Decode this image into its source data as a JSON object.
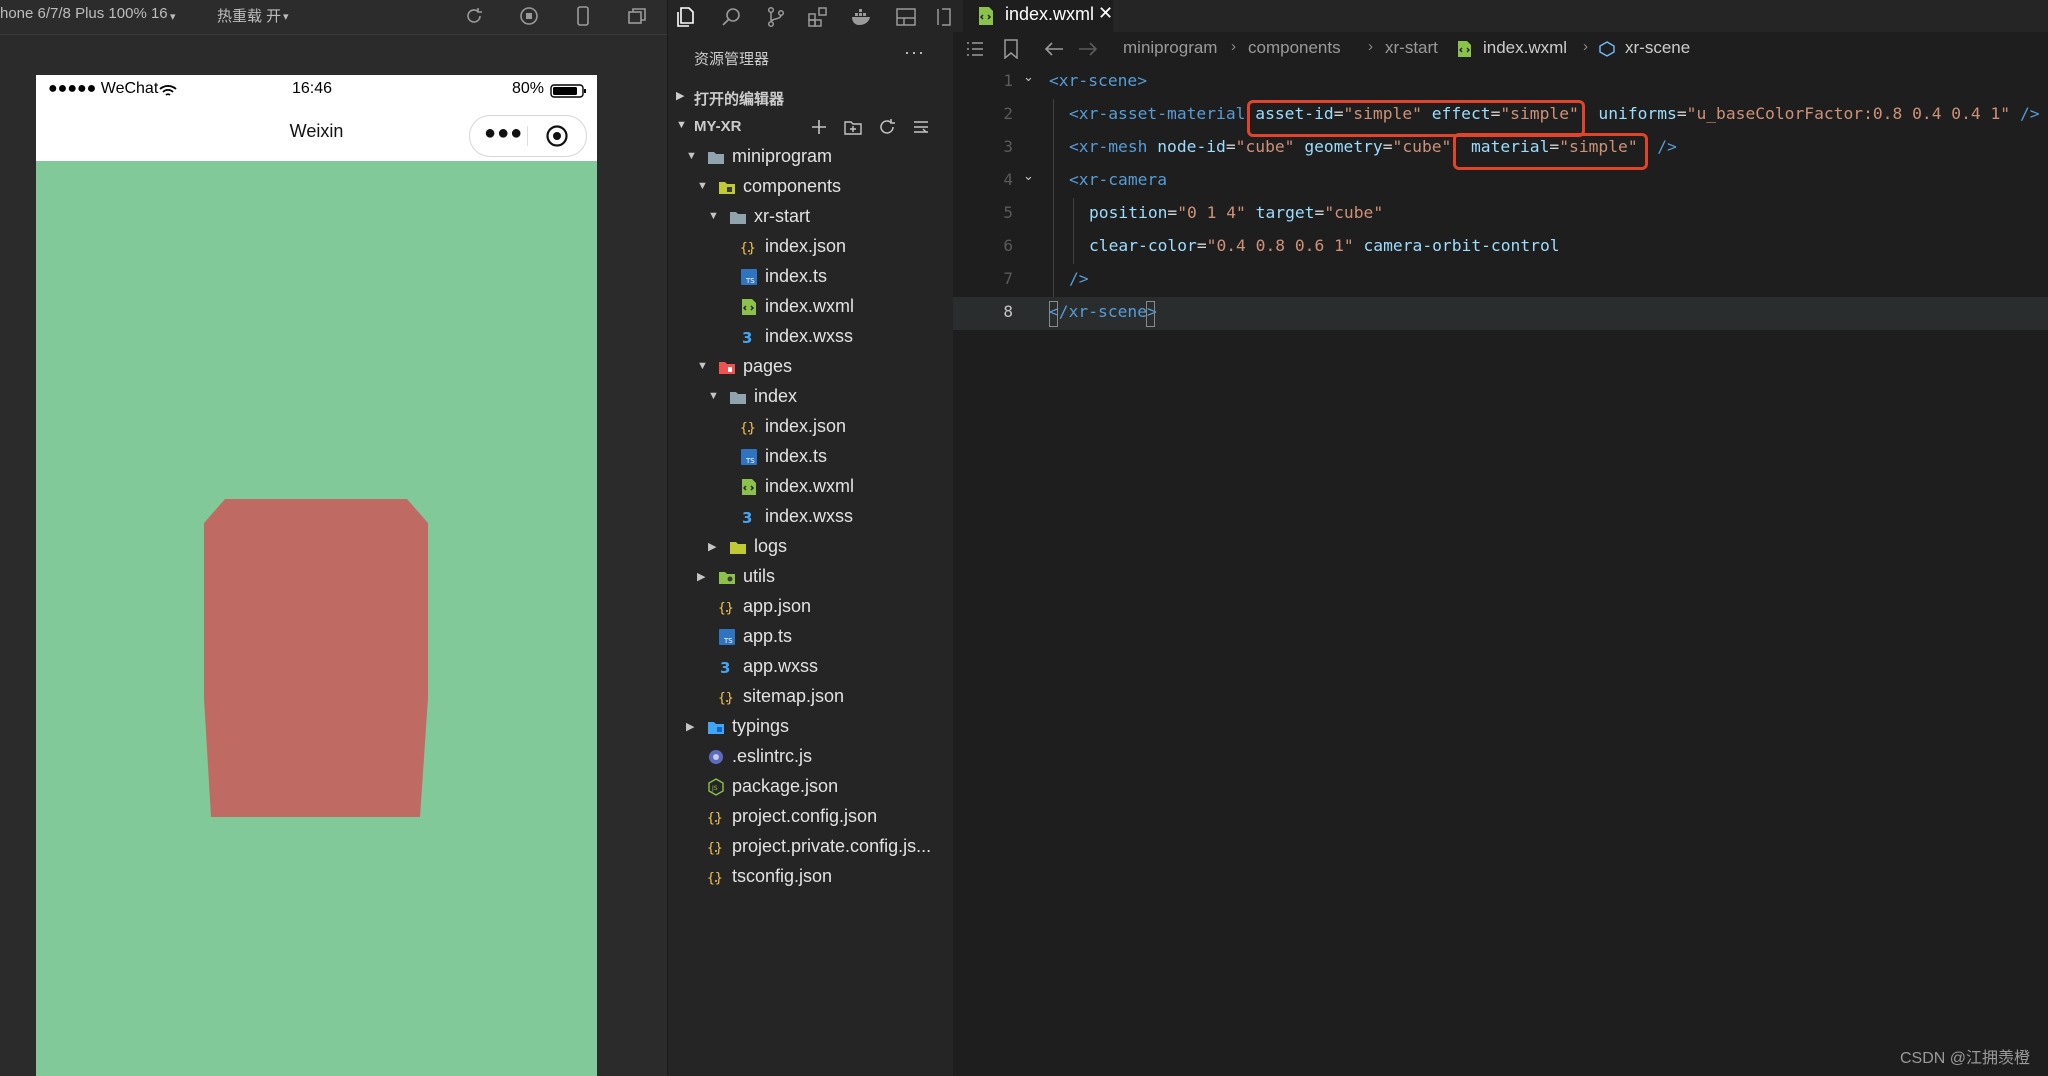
{
  "simulator": {
    "device_label": "hone 6/7/8 Plus 100% 16",
    "hot_reload_label": "热重载 开",
    "status_bar": {
      "carrier": "●●●●● WeChat",
      "time": "16:46",
      "battery": "80%"
    },
    "nav_title": "Weixin",
    "scene": {
      "background": "#81c999",
      "cube_color": "#c06a64"
    }
  },
  "explorer": {
    "title": "资源管理器",
    "open_editors_label": "打开的编辑器",
    "workspace_label": "MY-XR",
    "tree": [
      {
        "name": "miniprogram",
        "icon": "folder",
        "expanded": true
      },
      {
        "name": "components",
        "icon": "folder-components",
        "expanded": true
      },
      {
        "name": "xr-start",
        "icon": "folder",
        "expanded": true
      },
      {
        "name": "index.json",
        "icon": "json"
      },
      {
        "name": "index.ts",
        "icon": "ts"
      },
      {
        "name": "index.wxml",
        "icon": "wxml"
      },
      {
        "name": "index.wxss",
        "icon": "wxss"
      },
      {
        "name": "pages",
        "icon": "folder-pages",
        "expanded": true
      },
      {
        "name": "index",
        "icon": "folder",
        "expanded": true
      },
      {
        "name": "index.json",
        "icon": "json"
      },
      {
        "name": "index.ts",
        "icon": "ts"
      },
      {
        "name": "index.wxml",
        "icon": "wxml"
      },
      {
        "name": "index.wxss",
        "icon": "wxss"
      },
      {
        "name": "logs",
        "icon": "folder-logs",
        "expanded": false
      },
      {
        "name": "utils",
        "icon": "folder-utils",
        "expanded": false
      },
      {
        "name": "app.json",
        "icon": "json"
      },
      {
        "name": "app.ts",
        "icon": "ts"
      },
      {
        "name": "app.wxss",
        "icon": "wxss"
      },
      {
        "name": "sitemap.json",
        "icon": "json"
      },
      {
        "name": "typings",
        "icon": "folder-typings",
        "expanded": false
      },
      {
        "name": ".eslintrc.js",
        "icon": "eslint"
      },
      {
        "name": "package.json",
        "icon": "npm"
      },
      {
        "name": "project.config.json",
        "icon": "json"
      },
      {
        "name": "project.private.config.js...",
        "icon": "json"
      },
      {
        "name": "tsconfig.json",
        "icon": "json"
      }
    ]
  },
  "editor": {
    "tab_label": "index.wxml",
    "breadcrumb": [
      "miniprogram",
      "components",
      "xr-start",
      "index.wxml",
      "xr-scene"
    ],
    "lines": [
      {
        "num": "1",
        "tokens": [
          [
            "tag",
            "<xr-scene>"
          ]
        ]
      },
      {
        "num": "2",
        "tokens": [
          [
            "tag",
            "<xr-asset-material"
          ],
          [
            "plain",
            " "
          ],
          [
            "attr",
            "asset-id"
          ],
          [
            "plain",
            "="
          ],
          [
            "str",
            "\"simple\""
          ],
          [
            "plain",
            " "
          ],
          [
            "attr",
            "effect"
          ],
          [
            "plain",
            "="
          ],
          [
            "str",
            "\"simple\""
          ],
          [
            "plain",
            "  "
          ],
          [
            "attr",
            "uniforms"
          ],
          [
            "plain",
            "="
          ],
          [
            "str",
            "\"u_baseColorFactor:0.8 0.4 0.4 1\""
          ],
          [
            "plain",
            " "
          ],
          [
            "tag",
            "/>"
          ]
        ]
      },
      {
        "num": "3",
        "tokens": [
          [
            "tag",
            "<xr-mesh"
          ],
          [
            "plain",
            " "
          ],
          [
            "attr",
            "node-id"
          ],
          [
            "plain",
            "="
          ],
          [
            "str",
            "\"cube\""
          ],
          [
            "plain",
            " "
          ],
          [
            "attr",
            "geometry"
          ],
          [
            "plain",
            "="
          ],
          [
            "str",
            "\"cube\""
          ],
          [
            "plain",
            "  "
          ],
          [
            "attr",
            "material"
          ],
          [
            "plain",
            "="
          ],
          [
            "str",
            "\"simple\""
          ],
          [
            "plain",
            "  "
          ],
          [
            "tag",
            "/>"
          ]
        ]
      },
      {
        "num": "4",
        "tokens": [
          [
            "tag",
            "<xr-camera"
          ]
        ]
      },
      {
        "num": "5",
        "tokens": [
          [
            "attr",
            "position"
          ],
          [
            "plain",
            "="
          ],
          [
            "str",
            "\"0 1 4\""
          ],
          [
            "plain",
            " "
          ],
          [
            "attr",
            "target"
          ],
          [
            "plain",
            "="
          ],
          [
            "str",
            "\"cube\""
          ]
        ]
      },
      {
        "num": "6",
        "tokens": [
          [
            "attr",
            "clear-color"
          ],
          [
            "plain",
            "="
          ],
          [
            "str",
            "\"0.4 0.8 0.6 1\""
          ],
          [
            "plain",
            " "
          ],
          [
            "attr",
            "camera-orbit-control"
          ]
        ]
      },
      {
        "num": "7",
        "tokens": [
          [
            "tag",
            "/>"
          ]
        ]
      },
      {
        "num": "8",
        "tokens": [
          [
            "tag",
            "</xr-scene>"
          ]
        ]
      }
    ]
  },
  "watermark": "CSDN @江拥羡橙"
}
